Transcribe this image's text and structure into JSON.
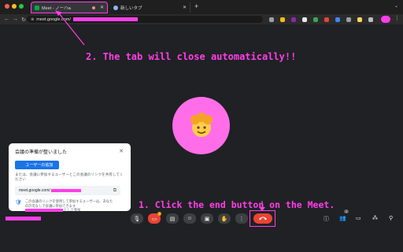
{
  "browser": {
    "tabs": [
      {
        "label": "Meet - ノーハw",
        "active": true
      },
      {
        "label": "新しいタブ",
        "active": false
      }
    ],
    "url_text": "meet.google.com/"
  },
  "annotations": {
    "step2": "2. The tab will close automatically!!",
    "step1": "1. Click the end button on the Meet."
  },
  "popup": {
    "title": "会議の準備が整いました",
    "add_button": "ユーザーの追加",
    "description": "または、会議に参加するユーザーとこの会議のリンクを共有してください",
    "link_text": "meet.google.com/",
    "note": "この会議のリンクを使用して参加するユーザーは、あなたの許可なしで会議に参加できます",
    "note_tail": "として参加"
  },
  "controls": {
    "left": [
      "mic-icon",
      "camera-icon",
      "captions-icon",
      "emoji-icon",
      "present-icon",
      "raise-hand-icon",
      "more-options-icon"
    ],
    "right": [
      "info-icon",
      "people-icon",
      "chat-icon",
      "activities-icon",
      "host-controls-icon"
    ],
    "camera_badge": "!",
    "people_count": "1"
  },
  "colors": {
    "highlight": "#ff3ee8",
    "end_call": "#ea4335",
    "avatar_bg": "#ff6ee8",
    "background": "#202124"
  }
}
